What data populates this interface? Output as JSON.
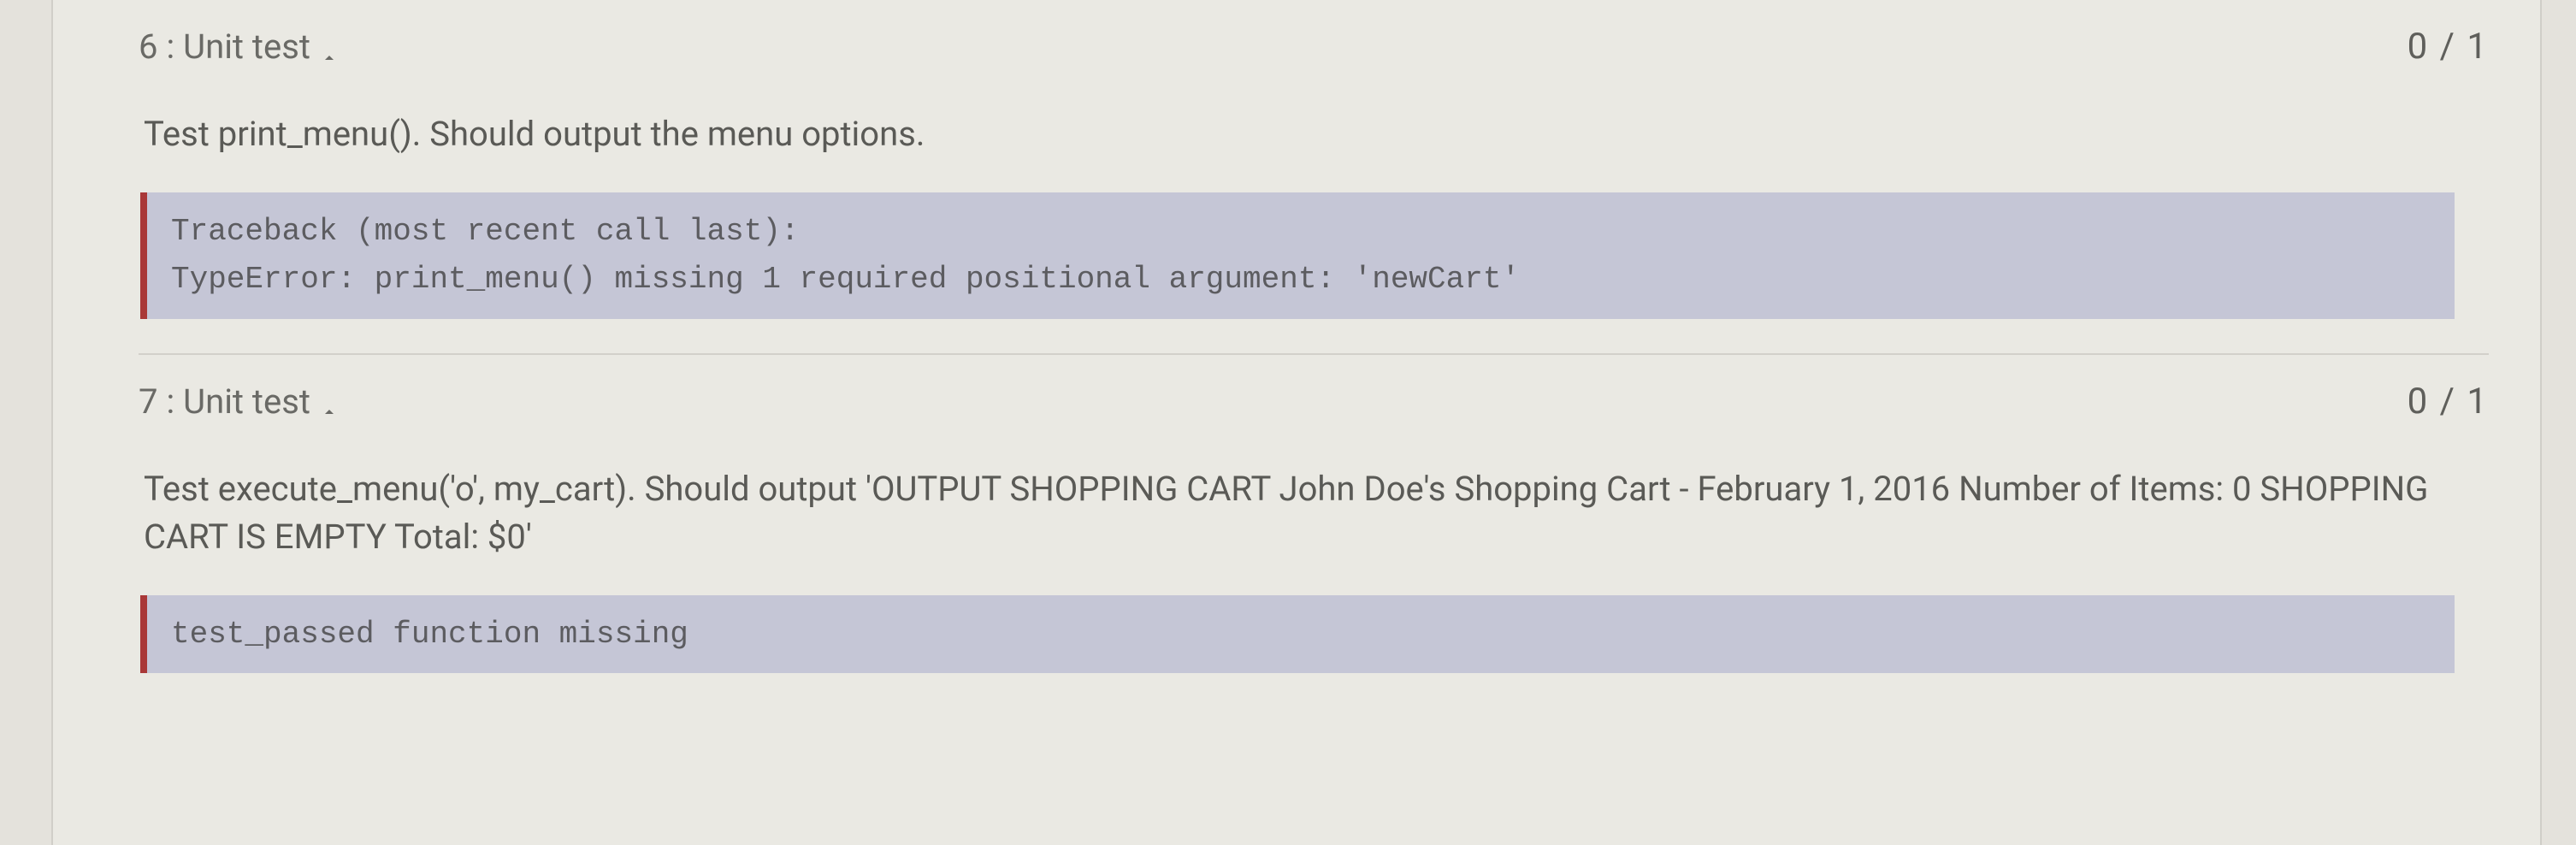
{
  "tests": [
    {
      "number": "6",
      "label": "Unit test",
      "score": "0 / 1",
      "description": "Test print_menu(). Should output the menu options.",
      "error": "Traceback (most recent call last):\nTypeError: print_menu() missing 1 required positional argument: 'newCart'"
    },
    {
      "number": "7",
      "label": "Unit test",
      "score": "0 / 1",
      "description": "Test execute_menu('o', my_cart). Should output 'OUTPUT SHOPPING CART John Doe's Shopping Cart - February 1, 2016 Number of Items: 0 SHOPPING CART IS EMPTY Total: $0'",
      "error": "test_passed function missing"
    }
  ]
}
